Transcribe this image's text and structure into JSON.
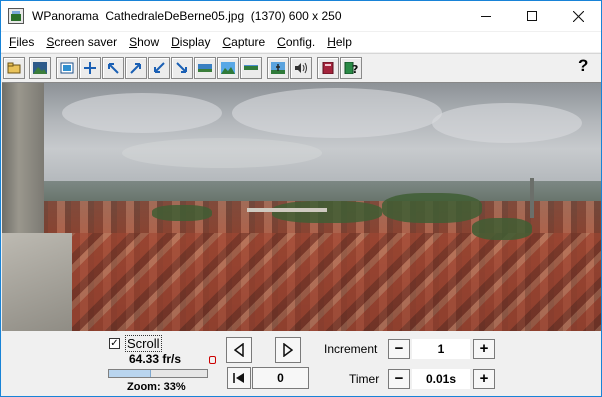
{
  "window": {
    "title": "WPanorama  CathedraleDeBerne05.jpg  (1370) 600 x 250",
    "app_icon": "wpanorama-app-icon",
    "controls": [
      "minimize-icon",
      "maximize-icon",
      "close-icon"
    ]
  },
  "menu": [
    {
      "pre": "",
      "ul": "F",
      "post": "iles"
    },
    {
      "pre": "",
      "ul": "S",
      "post": "creen saver"
    },
    {
      "pre": "",
      "ul": "S",
      "post": "how"
    },
    {
      "pre": "",
      "ul": "D",
      "post": "isplay"
    },
    {
      "pre": "",
      "ul": "C",
      "post": "apture"
    },
    {
      "pre": "",
      "ul": "C",
      "post": "onfig."
    },
    {
      "pre": "",
      "ul": "H",
      "post": "elp"
    }
  ],
  "toolbar": {
    "buttons": [
      "open-file-icon",
      "picture-icon",
      "fit-window-icon",
      "move-icon",
      "arrow-upleft-icon",
      "arrow-upright-icon",
      "arrow-downleft-icon",
      "arrow-downright-icon",
      "panorama-view-icon",
      "landscape-icon",
      "flat-view-icon",
      "person-scene-icon",
      "sound-icon",
      "book-icon",
      "help-book-icon"
    ],
    "help_label": "?"
  },
  "panorama": {
    "image": "Panoramic photo of Bern rooftops from the cathedral tower"
  },
  "controls": {
    "scroll_checked": "✓",
    "scroll_label": "Scroll",
    "fps": "64.33 fr/s",
    "zoom_label": "Zoom: 33%",
    "zoom_fraction": 0.43,
    "position_value": "0",
    "increment_label": "Increment",
    "increment_value": "1",
    "timer_label": "Timer",
    "timer_value": "0.01s",
    "minus": "−",
    "plus": "+"
  },
  "colors": {
    "accent": "#1883d7",
    "progress": "#b9d5ef"
  }
}
